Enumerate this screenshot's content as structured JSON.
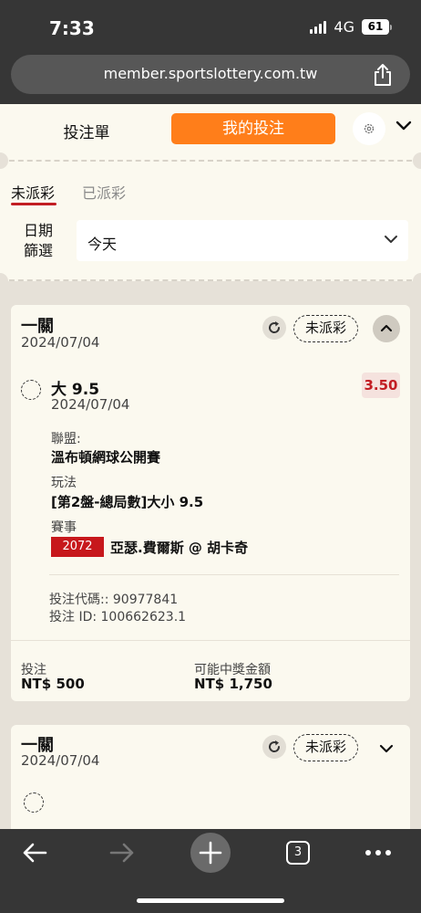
{
  "status_bar": {
    "time": "7:33",
    "network": "4G",
    "battery": "61"
  },
  "browser": {
    "url": "member.sportslottery.com.tw",
    "tabs_count": "3"
  },
  "header": {
    "tab_slip": "投注單",
    "tab_my_bets": "我的投注"
  },
  "filters": {
    "tab_unpaid": "未派彩",
    "tab_paid": "已派彩",
    "date_label_1": "日期",
    "date_label_2": "篩選",
    "date_value": "今天"
  },
  "bets": [
    {
      "type": "一關",
      "date": "2024/07/04",
      "status": "未派彩",
      "selection": "大 9.5",
      "selection_date": "2024/07/04",
      "odds": "3.50",
      "league_label": "聯盟:",
      "league": "溫布頓網球公開賽",
      "market_label": "玩法",
      "market": "[第2盤-總局數]大小 9.5",
      "event_label": "賽事",
      "event_code": "2072",
      "event_name": "亞瑟.費爾斯 @ 胡卡奇",
      "bet_code": "投注代碼:: 90977841",
      "bet_id": "投注 ID: 100662623.1",
      "stake_label": "投注",
      "stake": "NT$ 500",
      "payout_label": "可能中獎金額",
      "payout": "NT$ 1,750"
    },
    {
      "type": "一關",
      "date": "2024/07/04",
      "status": "未派彩"
    }
  ],
  "colors": {
    "accent": "#ff7e1a",
    "brand_red": "#c21d23",
    "odds_bg": "#f5e2de"
  }
}
